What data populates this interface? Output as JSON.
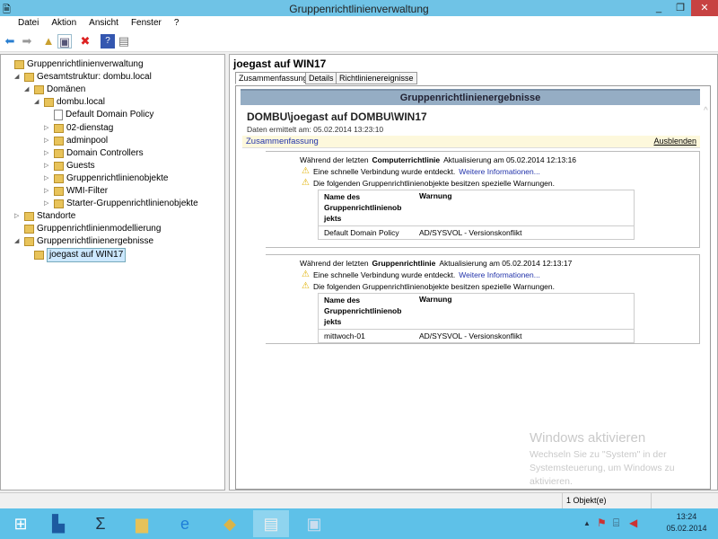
{
  "window": {
    "title": "Gruppenrichtlinienverwaltung",
    "minimize": "_",
    "restore": "❐",
    "close": "✕"
  },
  "menu": [
    "Datei",
    "Aktion",
    "Ansicht",
    "Fenster",
    "?"
  ],
  "tree": [
    {
      "label": "Gruppenrichtlinienverwaltung",
      "level": 0,
      "exp": ""
    },
    {
      "label": "Gesamtstruktur: dombu.local",
      "level": 1,
      "exp": "◢"
    },
    {
      "label": "Domänen",
      "level": 2,
      "exp": "◢"
    },
    {
      "label": "dombu.local",
      "level": 3,
      "exp": "◢"
    },
    {
      "label": "Default Domain Policy",
      "level": 4,
      "exp": ""
    },
    {
      "label": "02-dienstag",
      "level": 4,
      "exp": "▷"
    },
    {
      "label": "adminpool",
      "level": 4,
      "exp": "▷"
    },
    {
      "label": "Domain Controllers",
      "level": 4,
      "exp": "▷"
    },
    {
      "label": "Guests",
      "level": 4,
      "exp": "▷"
    },
    {
      "label": "Gruppenrichtlinienobjekte",
      "level": 4,
      "exp": "▷"
    },
    {
      "label": "WMI-Filter",
      "level": 4,
      "exp": "▷"
    },
    {
      "label": "Starter-Gruppenrichtlinienobjekte",
      "level": 4,
      "exp": "▷"
    },
    {
      "label": "Standorte",
      "level": 1,
      "exp": "▷"
    },
    {
      "label": "Gruppenrichtlinienmodellierung",
      "level": 1,
      "exp": ""
    },
    {
      "label": "Gruppenrichtlinienergebnisse",
      "level": 1,
      "exp": "◢"
    },
    {
      "label": "joegast auf WIN17",
      "level": 2,
      "exp": "",
      "selected": true
    }
  ],
  "right": {
    "title": "joegast auf WIN17",
    "tabs": [
      "Zusammenfassung",
      "Details",
      "Richtlinienereignisse"
    ],
    "header": "Gruppenrichtlinienergebnisse",
    "subject": "DOMBU\\joegast auf DOMBU\\WIN17",
    "collected": "Daten ermittelt am: 05.02.2014 13:23:10",
    "summary": "Zusammenfassung",
    "hide": "Ausblenden",
    "sections": [
      {
        "pre": "Während der letzten ",
        "bold": "Computerrichtlinie",
        "post": " Aktualisierung am 05.02.2014 12:13:16",
        "w1": "Eine schnelle Verbindung wurde entdeckt.",
        "more": "Weitere Informationen...",
        "w2": "Die folgenden Gruppenrichtlinienobjekte besitzen spezielle Warnungen.",
        "col1": "Name des Gruppenrichtlinienob jekts",
        "col2": "Warnung",
        "row1": "Default Domain Policy",
        "row2": "AD/SYSVOL - Versionskonflikt"
      },
      {
        "pre": "Während der letzten ",
        "bold": "Gruppenrichtlinie",
        "post": " Aktualisierung am 05.02.2014 12:13:17",
        "w1": "Eine schnelle Verbindung wurde entdeckt.",
        "more": "Weitere Informationen...",
        "w2": "Die folgenden Gruppenrichtlinienobjekte besitzen spezielle Warnungen.",
        "col1": "Name des Gruppenrichtlinienob jekts",
        "col2": "Warnung",
        "row1": "mittwoch-01",
        "row2": "AD/SYSVOL - Versionskonflikt"
      }
    ]
  },
  "watermark": {
    "title": "Windows aktivieren",
    "text": "Wechseln Sie zu \"System\" in der Systemsteuerung, um Windows zu aktivieren."
  },
  "status": "1 Objekt(e)",
  "clock": {
    "time": "13:24",
    "date": "05.02.2014"
  }
}
